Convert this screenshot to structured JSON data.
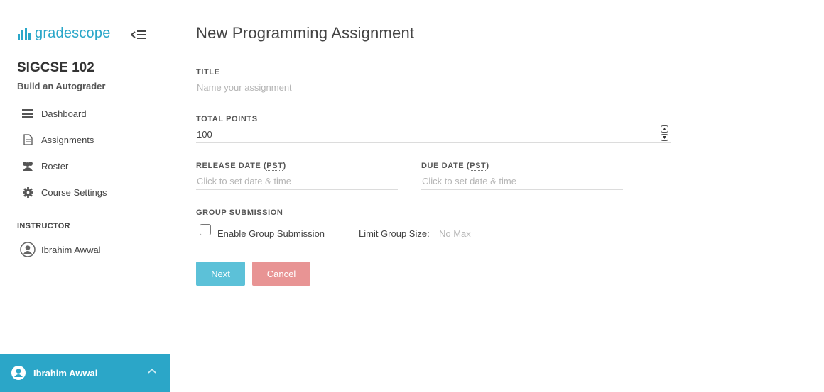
{
  "brand": {
    "name": "gradescope",
    "color": "#2aa7c9"
  },
  "sidebar": {
    "course_title": "SIGCSE 102",
    "course_subtitle": "Build an Autograder",
    "items": [
      {
        "label": "Dashboard",
        "icon": "dashboard-icon"
      },
      {
        "label": "Assignments",
        "icon": "document-icon"
      },
      {
        "label": "Roster",
        "icon": "users-icon"
      },
      {
        "label": "Course Settings",
        "icon": "gear-icon"
      }
    ],
    "instructor_heading": "INSTRUCTOR",
    "instructor_name": "Ibrahim Awwal",
    "footer_user": "Ibrahim Awwal"
  },
  "form": {
    "title": "New Programming Assignment",
    "title_label": "TITLE",
    "title_placeholder": "Name your assignment",
    "points_label": "TOTAL POINTS",
    "points_value": "100",
    "release_label_prefix": "RELEASE DATE (",
    "release_label_tz": "PST",
    "release_label_suffix": ")",
    "release_placeholder": "Click to set date & time",
    "due_label_prefix": "DUE DATE (",
    "due_label_tz": "PST",
    "due_label_suffix": ")",
    "due_placeholder": "Click to set date & time",
    "group_label": "GROUP SUBMISSION",
    "enable_group_label": "Enable Group Submission",
    "limit_label": "Limit Group Size:",
    "limit_placeholder": "No Max",
    "next_label": "Next",
    "cancel_label": "Cancel"
  },
  "colors": {
    "accent": "#2ba6c8",
    "next": "#5cc1d8",
    "cancel": "#e89494"
  }
}
